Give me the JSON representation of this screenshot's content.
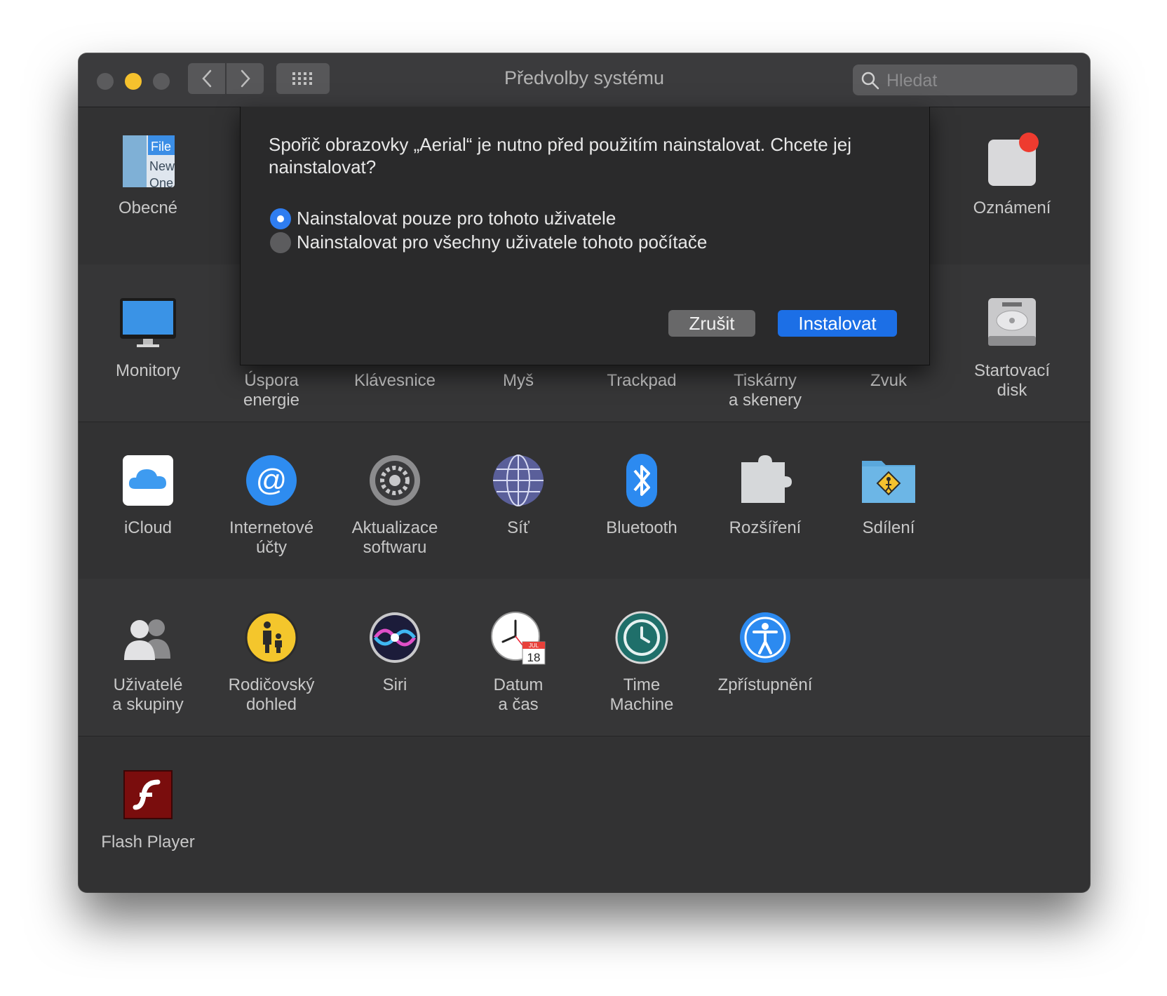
{
  "window": {
    "title": "Předvolby systému",
    "search_placeholder": "Hledat"
  },
  "panes": {
    "row1": [
      "Obecné",
      "Oznámení"
    ],
    "row2": [
      "Monitory",
      "Úspora\nenergie",
      "Klávesnice",
      "Myš",
      "Trackpad",
      "Tiskárny\na skenery",
      "Zvuk",
      "Startovací\ndisk"
    ],
    "row3": [
      "iCloud",
      "Internetové\núčty",
      "Aktualizace\nsoftwaru",
      "Síť",
      "Bluetooth",
      "Rozšíření",
      "Sdílení"
    ],
    "row4": [
      "Uživatelé\na skupiny",
      "Rodičovský\ndohled",
      "Siri",
      "Datum\na čas",
      "Time\nMachine",
      "Zpřístupnění"
    ],
    "row5": [
      "Flash Player"
    ]
  },
  "icon_texts": {
    "general_file": "File",
    "general_new": "New",
    "general_one": "One",
    "calendar_month": "JUL",
    "calendar_day": "18"
  },
  "dialog": {
    "message": "Spořič obrazovky „Aerial“ je nutno před použitím nainstalovat. Chcete jej nainstalovat?",
    "option_user": "Nainstalovat pouze pro tohoto uživatele",
    "option_all": "Nainstalovat pro všechny uživatele tohoto počítače",
    "selected_option": "option_user",
    "cancel_label": "Zrušit",
    "install_label": "Instalovat"
  },
  "colors": {
    "accent": "#1c6fe6",
    "window_bg": "#323233",
    "minimize_light": "#f5c12d"
  }
}
